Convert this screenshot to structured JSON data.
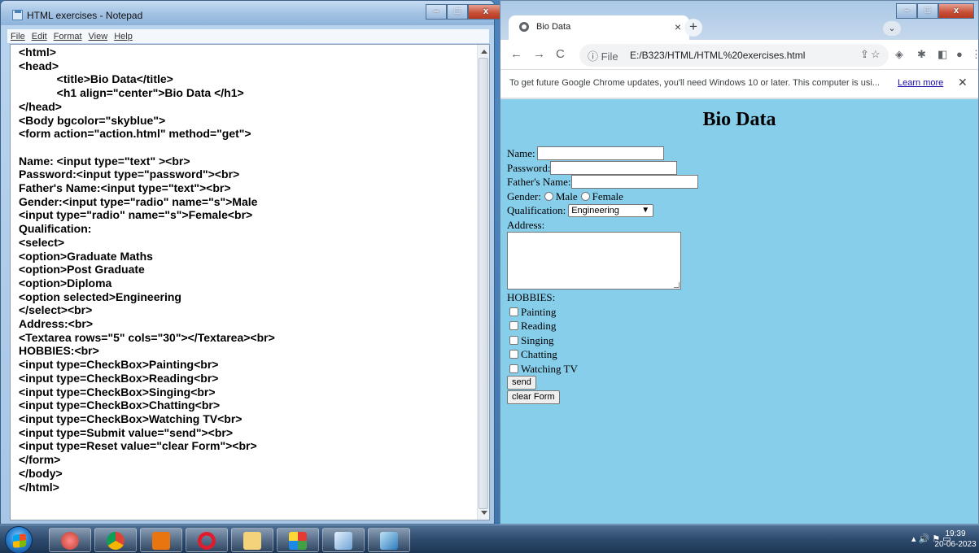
{
  "notepad": {
    "title": "HTML exercises - Notepad",
    "menu": [
      "File",
      "Edit",
      "Format",
      "View",
      "Help"
    ],
    "code_lines": [
      "<html>",
      "<head>",
      "            <title>Bio Data</title>",
      "            <h1 align=\"center\">Bio Data </h1>",
      "</head>",
      "<Body bgcolor=\"skyblue\">",
      "<form action=\"action.html\" method=\"get\">",
      "",
      "Name: <input type=\"text\" ><br>",
      "Password:<input type=\"password\"><br>",
      "Father's Name:<input type=\"text\"><br>",
      "Gender:<input type=\"radio\" name=\"s\">Male",
      "<input type=\"radio\" name=\"s\">Female<br>",
      "Qualification:",
      "<select>",
      "<option>Graduate Maths",
      "<option>Post Graduate",
      "<option>Diploma",
      "<option selected>Engineering",
      "</select><br>",
      "Address:<br>",
      "<Textarea rows=\"5\" cols=\"30\"></Textarea><br>",
      "HOBBIES:<br>",
      "<input type=CheckBox>Painting<br>",
      "<input type=CheckBox>Reading<br>",
      "<input type=CheckBox>Singing<br>",
      "<input type=CheckBox>Chatting<br>",
      "<input type=CheckBox>Watching TV<br>",
      "<input type=Submit value=\"send\"><br>",
      "<input type=Reset value=\"clear Form\"><br>",
      "</form>",
      "</body>",
      "</html>"
    ]
  },
  "chrome": {
    "tab_title": "Bio Data",
    "tab_close": "×",
    "new_tab": "+",
    "tab_search": "⌄",
    "address_prefix": "ⓘ File",
    "url": "E:/B323/HTML/HTML%20exercises.html",
    "infobar_message": "To get future Google Chrome updates, you'll need Windows 10 or later. This computer is usi...",
    "infobar_link": "Learn more",
    "infobar_close": "✕"
  },
  "page": {
    "heading": "Bio Data",
    "name_label": "Name:",
    "password_label": "Password:",
    "father_label": "Father's Name:",
    "gender_label": "Gender:",
    "gender_options": [
      "Male",
      "Female"
    ],
    "qualification_label": "Qualification:",
    "qualification_selected": "Engineering",
    "address_label": "Address:",
    "hobbies_label": "HOBBIES:",
    "hobbies": [
      "Painting",
      "Reading",
      "Singing",
      "Chatting",
      "Watching TV"
    ],
    "submit_label": "send",
    "reset_label": "clear Form",
    "background_color": "#87ceeb"
  },
  "taskbar": {
    "time": "19:39",
    "date": "20-06-2023"
  }
}
